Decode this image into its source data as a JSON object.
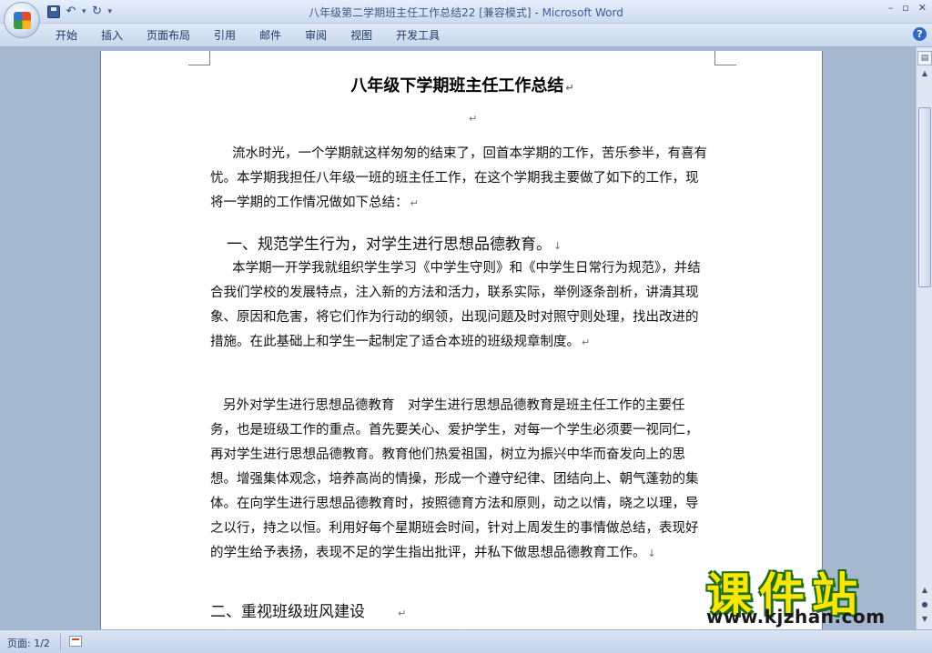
{
  "window": {
    "title": "八年级第二学期班主任工作总结22 [兼容模式]",
    "title_sep": " - ",
    "app_name": "Microsoft Word"
  },
  "quick_access": [
    "save-icon",
    "undo-icon",
    "redo-icon"
  ],
  "ribbon": {
    "tabs": [
      "开始",
      "插入",
      "页面布局",
      "引用",
      "邮件",
      "审阅",
      "视图",
      "开发工具"
    ],
    "help": "?"
  },
  "document": {
    "title": "八年级下学期班主任工作总结",
    "para_intro": "流水时光，一个学期就这样匆匆的结束了，回首本学期的工作，苦乐参半，有喜有忧。本学期我担任八年级一班的班主任工作，在这个学期我主要做了如下的工作，现将一学期的工作情况做如下总结：",
    "heading1": "一、规范学生行为，对学生进行思想品德教育。",
    "para1": "本学期一开学我就组织学生学习《中学生守则》和《中学生日常行为规范》，并结合我们学校的发展特点，注入新的方法和活力，联系实际，举例逐条剖析，讲清其现象、原因和危害，将它们作为行动的纲领，出现问题及时对照守则处理，找出改进的措施。在此基础上和学生一起制定了适合本班的班级规章制度。",
    "para2": "另外对学生进行思想品德教育　对学生进行思想品德教育是班主任工作的主要任务，也是班级工作的重点。首先要关心、爱护学生，对每一个学生必须要一视同仁，再对学生进行思想品德教育。教育他们热爱祖国，树立为振兴中华而奋发向上的思想。增强集体观念，培养高尚的情操，形成一个遵守纪律、团结向上、朝气蓬勃的集体。在向学生进行思想品德教育时，按照德育方法和原则，动之以情，晓之以理，导之以行，持之以恒。利用好每个星期班会时间，针对上周发生的事情做总结，表现好的学生给予表扬，表现不足的学生指出批评，并私下做思想品德教育工作。",
    "heading2": "二、重视班级班风建设",
    "para_mark": "↵",
    "line_mark": "↓"
  },
  "status": {
    "page": "页面: 1/2"
  },
  "watermark": {
    "text": "课件站",
    "url": "www.kjzhan.com"
  }
}
